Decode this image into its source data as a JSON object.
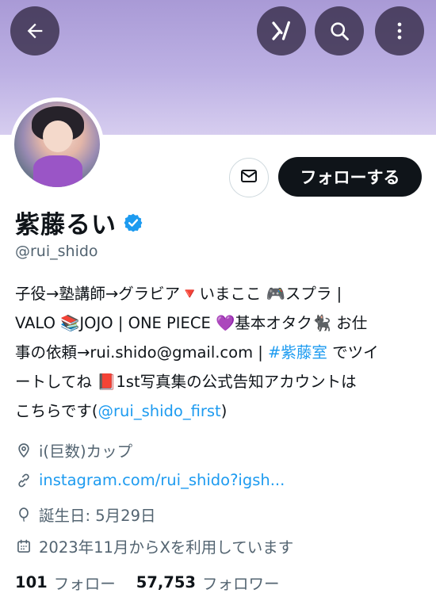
{
  "header": {
    "back_icon": "arrow-left-icon",
    "grok_icon": "grok-icon",
    "search_icon": "search-icon",
    "more_icon": "more-vertical-icon",
    "banner_color": "#bdb1e4"
  },
  "profile": {
    "display_name": "紫藤るい",
    "handle": "@rui_shido",
    "verified_color": "#1d9bf0",
    "message_icon": "envelope-icon",
    "follow_label": "フォローする"
  },
  "bio": {
    "line1": "子役→塾講師→グラビア🔻いまここ 🎮スプラ |",
    "line2": "VALO 📚JOJO | ONE PIECE 💜基本オタク🐈‍⬛ お仕",
    "line3_pre": "事の依頼→rui.shido@gmail.com | ",
    "line3_tag": "#紫藤室",
    "line3_post": " でツイ",
    "line4": "ートしてね 📕1st写真集の公式告知アカウントは",
    "line5_pre": "こちらです(",
    "line5_mention": "@rui_shido_first",
    "line5_post": ")"
  },
  "meta": {
    "location": "i(巨数)カップ",
    "location_icon": "location-pin-icon",
    "website": "instagram.com/rui_shido?igsh...",
    "website_icon": "link-icon",
    "birthday": "誕生日: 5月29日",
    "birthday_icon": "balloon-icon",
    "joined": "2023年11月からXを利用しています",
    "joined_icon": "calendar-icon"
  },
  "stats": {
    "following_count": "101",
    "following_label": "フォロー",
    "followers_count": "57,753",
    "followers_label": "フォロワー"
  }
}
